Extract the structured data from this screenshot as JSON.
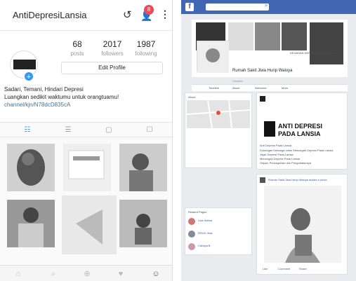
{
  "instagram": {
    "username": "AntiDepresiLansia",
    "notification_count": "8",
    "stats": [
      {
        "value": "68",
        "label": "posts"
      },
      {
        "value": "2017",
        "label": "followers"
      },
      {
        "value": "1987",
        "label": "following"
      }
    ],
    "edit_profile_label": "Edit Profile",
    "bio_line1": "Sadari, Temani, Hindari Depresi",
    "bio_line2": "Luangkan sedikit waktumu untuk orangtuamu!",
    "bio_link": "channel/kjn/N78dcD835cA",
    "avatar_logo_text": "ANTI DEPRESI PADA LANSIA",
    "icons": {
      "history": "history-icon",
      "add_user": "add-user-icon",
      "more": "more-icon"
    },
    "tabs": [
      "grid",
      "list",
      "tagged",
      "saved"
    ],
    "nav": [
      "home",
      "search",
      "add",
      "activity",
      "profile"
    ],
    "grid_overlays": [
      "Anti Depresi pada Lansia",
      "Jenis Jenis Depresi"
    ]
  },
  "facebook": {
    "page_name": "Rumah Sakit Jiwa Hurip Waluya",
    "page_category": "Hospital",
    "cover_text": "KEJADIAN DEPRESI PADA LANSIA",
    "subnav": [
      "Timeline",
      "About",
      "Welcome",
      "More"
    ],
    "post_logo_line1": "ANTI DEPRESI",
    "post_logo_line2": "PADA LANSIA",
    "post1_title": "Anti Depresi Pada Lansia",
    "post1_lines": [
      "Dukungan Keluarga untuk Mencegah Depresi Pada Lansia",
      "Jejak Depresi Pada Lansia",
      "Mencegah Depresi Pada Lansia",
      "Gejala, Pencegahan dan Pengobatannya"
    ],
    "post2_title": "Rumah Sakit Jiwa Hurip Waluya added a photo",
    "related_header": "Related Pages",
    "related": [
      "Lisa Halma",
      "RSUD Jiwa",
      "Cahaya B"
    ],
    "like_label": "Like",
    "comment_label": "Comment",
    "share_label": "Share",
    "info_header": "About"
  }
}
